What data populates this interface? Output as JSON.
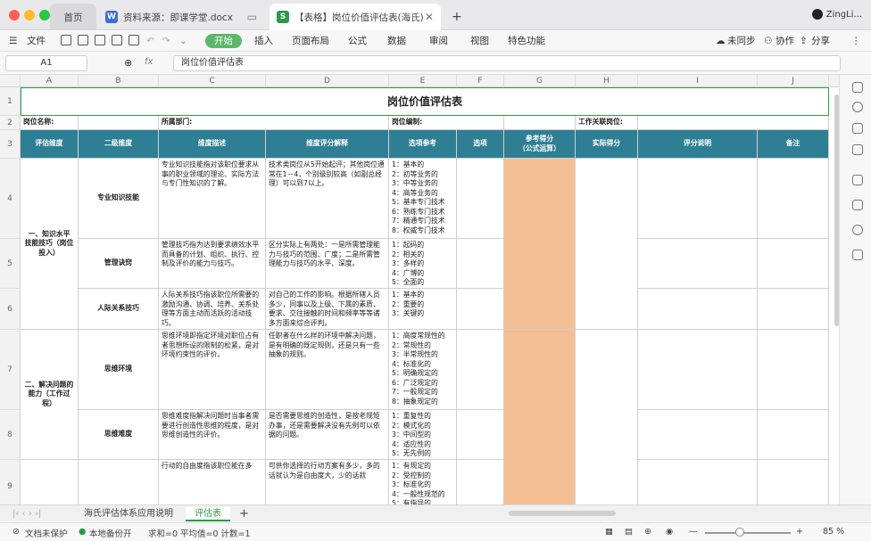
{
  "window": {
    "tabs": [
      {
        "label": "首页"
      },
      {
        "label": "资料来源：即课学堂.docx"
      },
      {
        "label": "【表格】岗位价值评估表(海氏)"
      }
    ],
    "new_tab": "+",
    "user": "ZingLi..."
  },
  "menu": {
    "file": "文件",
    "items": [
      "开始",
      "插入",
      "页面布局",
      "公式",
      "数据",
      "审阅",
      "视图",
      "特色功能"
    ],
    "sync": "未同步",
    "collab": "协作",
    "share": "分享"
  },
  "formula": {
    "cell_ref": "A1",
    "fx": "fx",
    "content": "岗位价值评估表"
  },
  "sheet": {
    "columns": [
      "A",
      "B",
      "C",
      "D",
      "E",
      "F",
      "G",
      "H",
      "I",
      "J"
    ],
    "rows": [
      "1",
      "2",
      "3",
      "4",
      "5",
      "6",
      "7",
      "8",
      "9"
    ],
    "title": "岗位价值评估表",
    "row2": {
      "position_name": "岗位名称:",
      "department": "所属部门:",
      "headcount": "岗位编制:",
      "work_relation": "工作关联岗位:"
    },
    "headers": [
      "评估维度",
      "二级维度",
      "维度描述",
      "维度评分解释",
      "选项参考",
      "选项",
      "参考得分\n（公式运算）",
      "实际得分",
      "评分说明",
      "备注"
    ],
    "dim1": "一、知识水平\n技能技巧（岗位\n投入）",
    "dim2": "二、解决问题的\n能力（工作过\n程）",
    "rows_data": [
      {
        "sub": "专业知识技能",
        "desc": "专业知识技能指对该职位要求从事的职业领域的理论、实际方法与专门性知识的了解。",
        "explain": "技术类岗位从5开始起评；其他岗位通常在1－4，个别级别较高（如副总经理）可以到7以上。",
        "options": [
          "1：基本的",
          "2：初等业务的",
          "3：中等业务的",
          "4：高等业务的",
          "5：基本专门技术",
          "6：熟练专门技术",
          "7：精通专门技术",
          "8：权威专门技术"
        ]
      },
      {
        "sub": "管理诀窍",
        "desc": "管理技巧指为达到要求绩效水平而具备的计划、组织、执行、控制及评价的能力与技巧。",
        "explain": "区分实际上有两处：一是所需管理能力与技巧的范围、广度；二是所需管理能力与技巧的水平、深度。",
        "options": [
          "1：起码的",
          "2：相关的",
          "3：多样的",
          "4：广博的",
          "5：全面的"
        ]
      },
      {
        "sub": "人际关系技巧",
        "desc": "人际关系技巧指该职位所需要的激励沟通、协调、培养、关系处理等方面主动而活跃的活动技巧。",
        "explain": "对自己的工作的影响。根据所辖人员多少，同事以及上级、下属的素质、要求、交往接触的时间和频率等等诸多方面来综合评判。",
        "options": [
          "1：基本的",
          "2：重要的",
          "3：关键的"
        ]
      },
      {
        "sub": "思维环境",
        "desc": "思维环境即指定环境对职位占有者思想所设的限制的松紧，是对环境约束性的评价。",
        "explain": "任职者在什么样的环境中解决问题，是有明确的既定规则，还是只有一些抽象的规则。",
        "options": [
          "1：高度常规性的",
          "2：常规性的",
          "3：半常规性的",
          "4：标准化的",
          "5：明确规定的",
          "6：广泛规定的",
          "7：一般规定的",
          "8：抽象规定的"
        ]
      },
      {
        "sub": "思维难度",
        "desc": "思维难度指解决问题时当事者需要进行创造性思维的程度，是对思维创造性的评价。",
        "explain": "是否需要思维的创造性，是按老规矩办事，还是需要解决没有先例可以依据的问题。",
        "options": [
          "1：重复性的",
          "2：模式化的",
          "3：中间型的",
          "4：适应性的",
          "5：无先例的"
        ]
      },
      {
        "sub": "",
        "desc": "行动的自由度指该职位能在多",
        "explain": "可供你选择的行动方案有多少，多的话就认为是自由度大，少的话就",
        "options": [
          "1：有规定的",
          "2：受控制的",
          "3：标准化的",
          "4：一般性规范的",
          "5：有指导的"
        ]
      }
    ]
  },
  "sheet_tabs": [
    "海氏评估体系应用说明",
    "评估表"
  ],
  "status": {
    "protect": "文档未保护",
    "backup": "本地备份开",
    "stats": "求和=0  平均值=0  计数=1",
    "zoom": "85 %"
  },
  "colors": {
    "header_teal": "#2f7f94",
    "ref_score": "#f4bf95",
    "accent_green": "#5bb86a"
  }
}
